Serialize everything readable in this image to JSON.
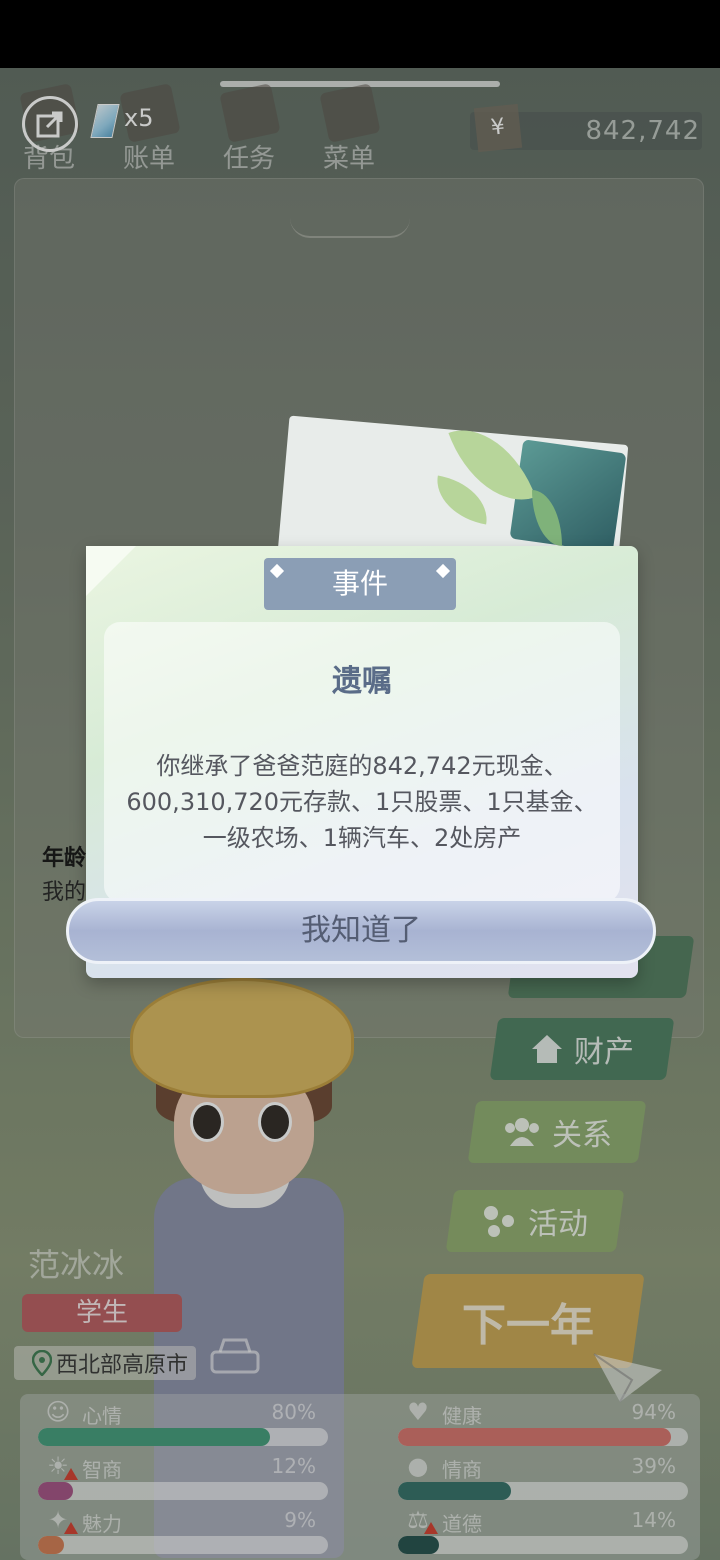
{
  "hud": {
    "gem_count": "x5",
    "money": "842,742",
    "money_symbol": "¥",
    "nav": [
      {
        "label": "背包",
        "icon": "bag-icon"
      },
      {
        "label": "账单",
        "icon": "bill-icon"
      },
      {
        "label": "任务",
        "icon": "task-icon"
      },
      {
        "label": "菜单",
        "icon": "menu-icon"
      }
    ]
  },
  "log": {
    "age_label": "年龄",
    "text": "我的"
  },
  "dialog": {
    "tab": "事件",
    "heading": "遗嘱",
    "body": "你继承了爸爸范庭的842,742元现金、600,310,720元存款、1只股票、1只基金、一级农场、1辆汽车、2处房产",
    "confirm": "我知道了"
  },
  "side_buttons": {
    "property": "财产",
    "relations": "关系",
    "activities": "活动",
    "next_year": "下一年"
  },
  "character": {
    "name": "范冰冰",
    "job": "学生",
    "location": "西北部高原市"
  },
  "stats": [
    {
      "name": "心情",
      "value": "80%",
      "fraction": 0.8,
      "color": "#3f9a78",
      "icon": "smile-icon",
      "warn": false
    },
    {
      "name": "健康",
      "value": "94%",
      "fraction": 0.94,
      "color": "#d6706a",
      "icon": "heart-icon",
      "warn": false
    },
    {
      "name": "智商",
      "value": "12%",
      "fraction": 0.12,
      "color": "#a24e82",
      "icon": "bulb-icon",
      "warn": true
    },
    {
      "name": "情商",
      "value": "39%",
      "fraction": 0.39,
      "color": "#2f6d64",
      "icon": "apple-icon",
      "warn": false
    },
    {
      "name": "魅力",
      "value": "9%",
      "fraction": 0.09,
      "color": "#d1794f",
      "icon": "sparkle-icon",
      "warn": true
    },
    {
      "name": "道德",
      "value": "14%",
      "fraction": 0.14,
      "color": "#1f4d48",
      "icon": "scale-icon",
      "warn": true
    }
  ],
  "colors": {
    "dialog_tab": "#8b9eb5",
    "heading": "#5a6c88",
    "next_year": "#c9a450",
    "job_badge": "#b85a5e"
  }
}
